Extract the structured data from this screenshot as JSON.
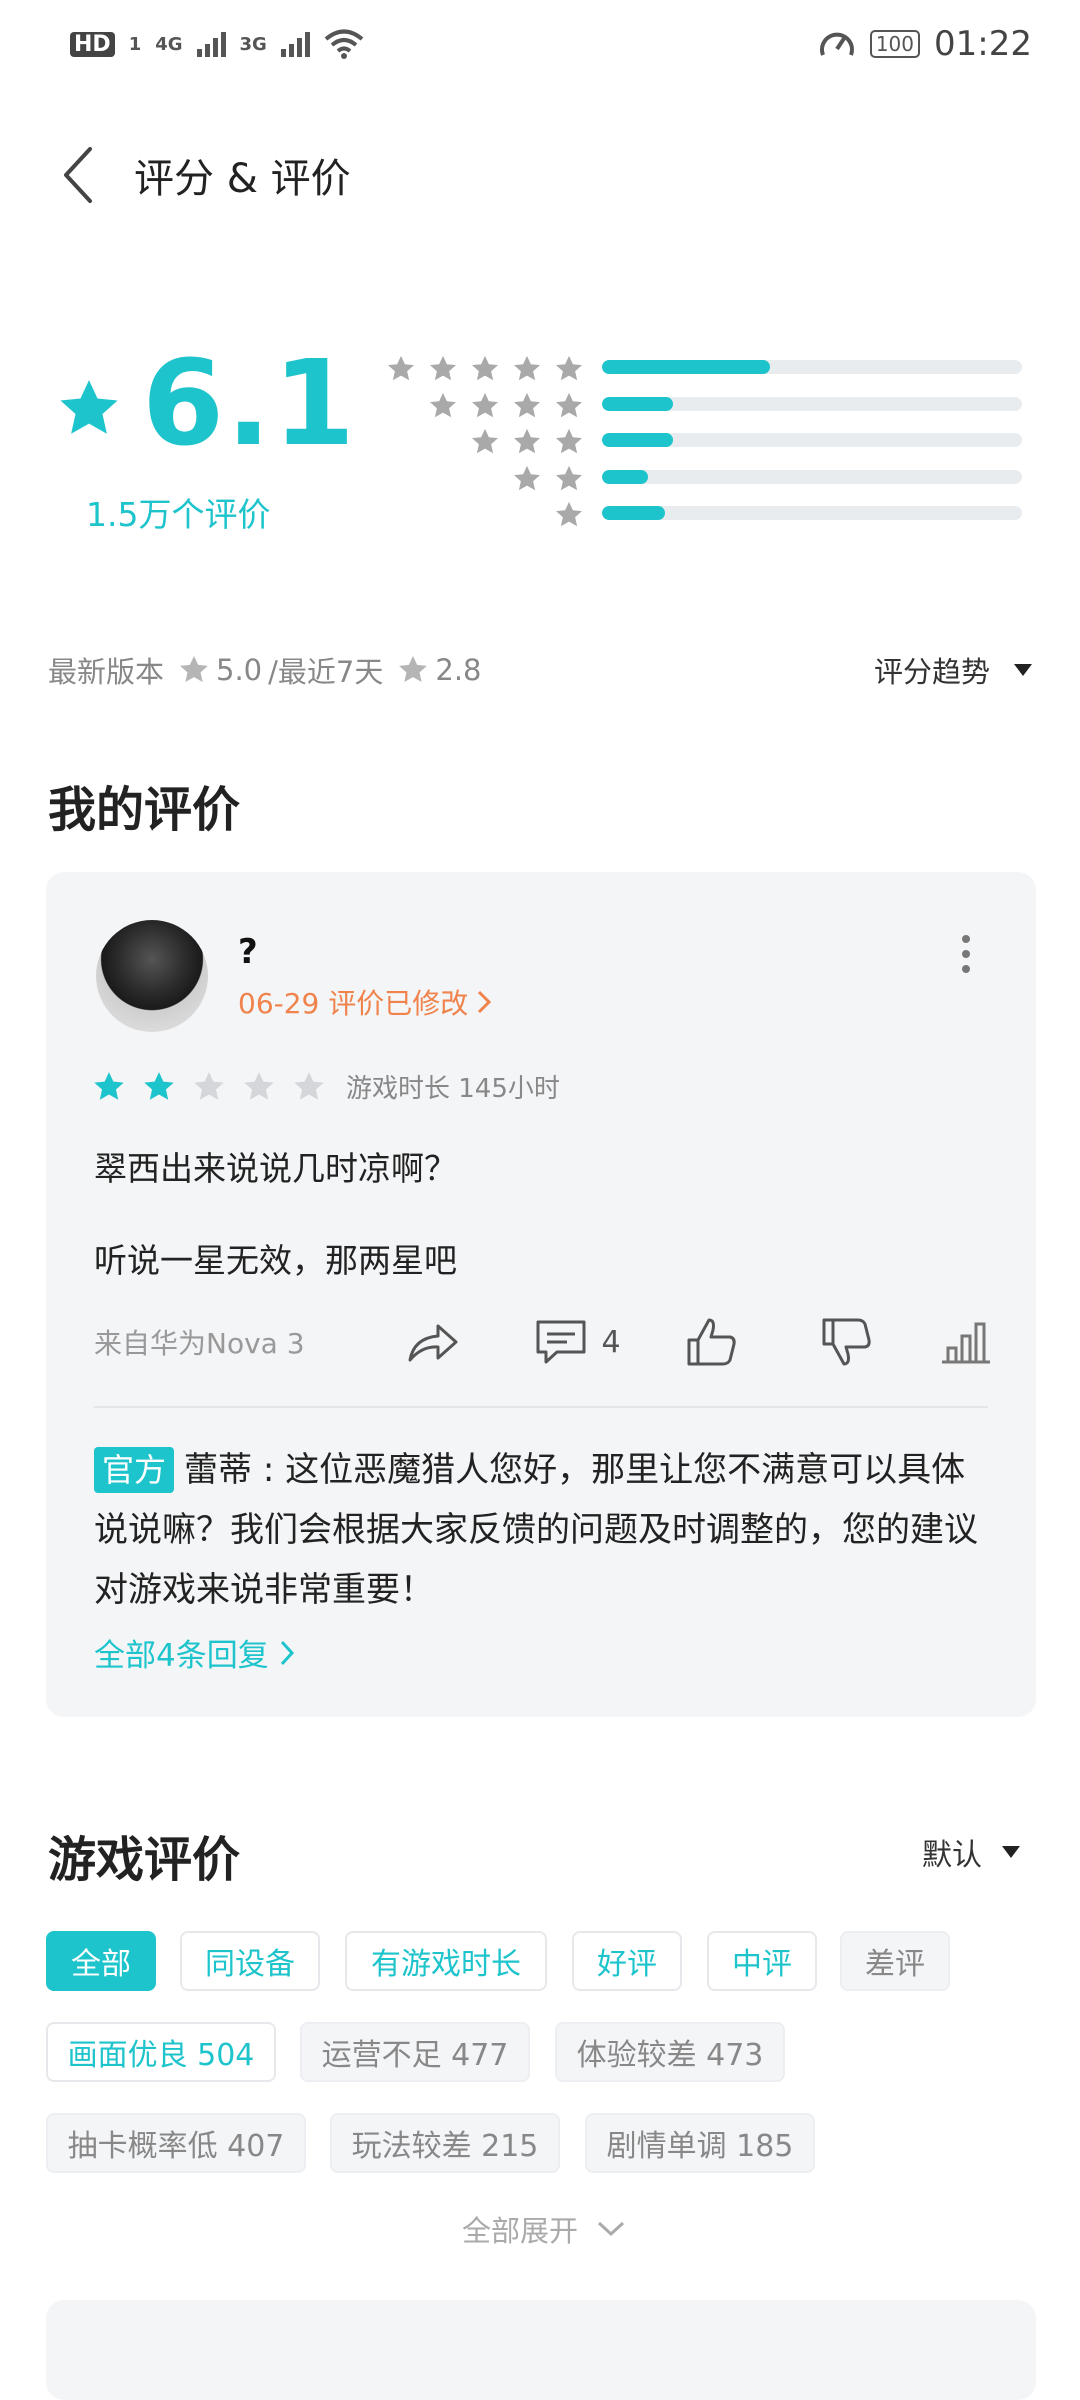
{
  "status_bar": {
    "hd": "HD",
    "sim": "1",
    "net1": "4G",
    "net2": "3G",
    "battery": "100",
    "time": "01:22"
  },
  "header": {
    "title": "评分 & 评价"
  },
  "summary": {
    "score": "6.1",
    "count": "1.5万个评价",
    "distribution": [
      {
        "stars": 5,
        "fraction": 0.4
      },
      {
        "stars": 4,
        "fraction": 0.17
      },
      {
        "stars": 3,
        "fraction": 0.17
      },
      {
        "stars": 2,
        "fraction": 0.11
      },
      {
        "stars": 1,
        "fraction": 0.15
      }
    ]
  },
  "meta": {
    "latest_version_label": "最新版本",
    "latest_version_score": "5.0",
    "recent_label": "/最近7天",
    "recent_score": "2.8",
    "trend_label": "评分趋势"
  },
  "my_review": {
    "section_title": "我的评价",
    "user_name": "?",
    "date_text": "06-29 评价已修改",
    "rating": 2,
    "playtime": "游戏时长 145小时",
    "line1": "翠西出来说说几时凉啊？",
    "line2": "听说一星无效，那两星吧",
    "device": "来自华为Nova 3",
    "comment_count": "4",
    "official_tag": "官方",
    "reply_text": "蕾蒂 : 这位恶魔猎人您好，那里让您不满意可以具体说说嘛？我们会根据大家反馈的问题及时调整的，您的建议对游戏来说非常重要！",
    "all_replies": "全部4条回复"
  },
  "game_reviews": {
    "section_title": "游戏评价",
    "sort_label": "默认",
    "filters": [
      "全部",
      "同设备",
      "有游戏时长",
      "好评",
      "中评",
      "差评"
    ],
    "tags": [
      "画面优良 504",
      "运营不足 477",
      "体验较差 473",
      "抽卡概率低 407",
      "玩法较差 215",
      "剧情单调 185"
    ],
    "expand_label": "全部展开"
  },
  "colors": {
    "accent": "#1ec4cc",
    "orange": "#f0834c",
    "card_bg": "#f4f5f7"
  }
}
